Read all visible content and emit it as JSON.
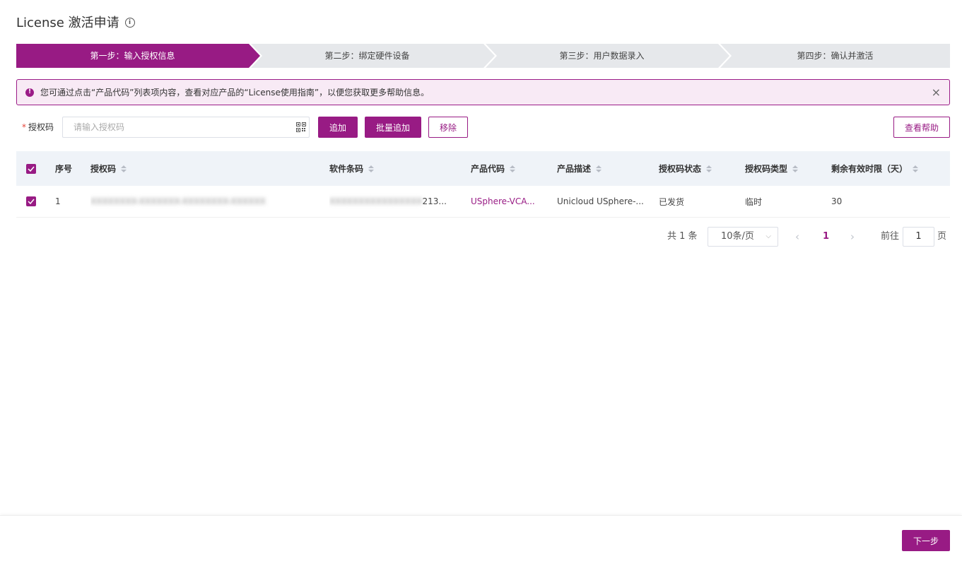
{
  "page": {
    "title": "License 激活申请",
    "title_info_icon": "info-circle-icon"
  },
  "steps": [
    {
      "label": "第一步：输入授权信息",
      "active": true
    },
    {
      "label": "第二步：绑定硬件设备",
      "active": false
    },
    {
      "label": "第三步：用户数据录入",
      "active": false
    },
    {
      "label": "第四步：确认并激活",
      "active": false
    }
  ],
  "alert": {
    "icon": "exclamation-circle-icon",
    "text": "您可通过点击“产品代码”列表项内容，查看对应产品的“License使用指南”，以便您获取更多帮助信息。",
    "close_icon": "close-icon"
  },
  "form": {
    "label": "授权码",
    "required_mark": "*",
    "input_value": "",
    "input_placeholder": "请输入授权码",
    "scan_icon": "qr-code-icon",
    "add_label": "追加",
    "batch_add_label": "批量追加",
    "remove_label": "移除",
    "help_label": "查看帮助"
  },
  "table": {
    "headers": {
      "index": "序号",
      "auth_code": "授权码",
      "software_barcode": "软件条码",
      "product_code": "产品代码",
      "product_desc": "产品描述",
      "auth_status": "授权码状态",
      "auth_type": "授权码类型",
      "remaining_days": "剩余有效时限（天）"
    },
    "header_checked": true,
    "rows": [
      {
        "checked": true,
        "index": "1",
        "auth_code": "XXXXXXXX-XXXXXXX-XXXXXXXX-XXXXXX",
        "software_barcode_hidden": "XXXXXXXXXXXXXXXX",
        "software_barcode_visible": "213...",
        "product_code": "USphere-VCA...",
        "product_desc": "Unicloud USphere-...",
        "auth_status": "已发货",
        "auth_type": "临时",
        "remaining_days": "30"
      }
    ]
  },
  "pagination": {
    "total_text": "共 1 条",
    "page_size": "10条/页",
    "current_page": "1",
    "goto_label": "前往",
    "goto_value": "1",
    "page_unit": "页"
  },
  "footer": {
    "next_label": "下一步"
  },
  "colors": {
    "accent": "#981b84",
    "step_inactive": "#e6e8eb",
    "alert_bg": "#f8eaf5",
    "header_bg": "#eff3f8"
  }
}
